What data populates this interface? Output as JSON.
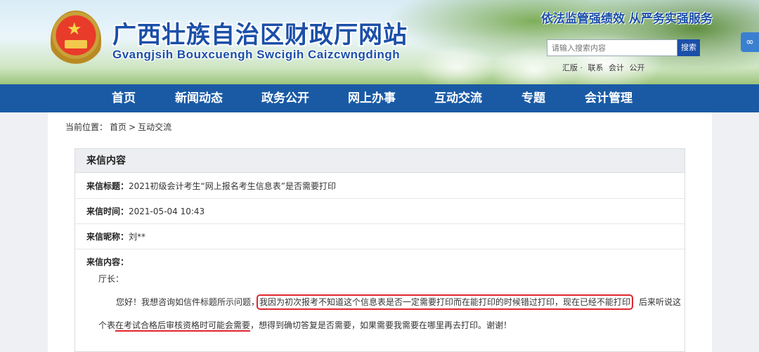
{
  "header": {
    "site_title": "广西壮族自治区财政厅网站",
    "site_pinyin": "Gvangjsih Bouxcuengh Swcigih Caizcwngdingh",
    "slogan": "依法监管强绩效  从严务实强服务",
    "search": {
      "placeholder": "请输入搜索内容",
      "button_label": "搜索"
    },
    "quick_links": [
      "汇版 ·",
      "联系",
      "会计",
      "公开"
    ]
  },
  "nav": {
    "items": [
      "首页",
      "新闻动态",
      "政务公开",
      "网上办事",
      "互动交流",
      "专题",
      "会计管理"
    ]
  },
  "breadcrumb": {
    "prefix": "当前位置：",
    "items": [
      "首页",
      ">",
      "互动交流"
    ]
  },
  "letter": {
    "section_title": "来信内容",
    "title_label": "来信标题：",
    "title_value": "2021初级会计考生“网上报名考生信息表”是否需要打印",
    "time_label": "来信时间：",
    "time_value": "2021-05-04 10:43",
    "nickname_label": "来信昵称：",
    "nickname_value": "刘**",
    "content_label": "来信内容：",
    "greeting": "厅长：",
    "line1_start": "您好！我想咨询如信件标题所示问题，",
    "line1_highlight": "我因为初次报考不知道这个信息表是否一定需要打印而在能打印的时候错过打印，现在已经不能打印",
    "line1_end": "，后来听说这",
    "line2_start": "个表",
    "line2_underlined": "在考试合格后审核资格时可能会需要",
    "line2_end": "，想得到确切答复是否需要，如果需要我需要在哪里再去打印。谢谢！"
  },
  "colors": {
    "nav_blue": "#1a5aa5",
    "title_blue": "#1b4fa8",
    "highlight_red": "#e0262f"
  }
}
